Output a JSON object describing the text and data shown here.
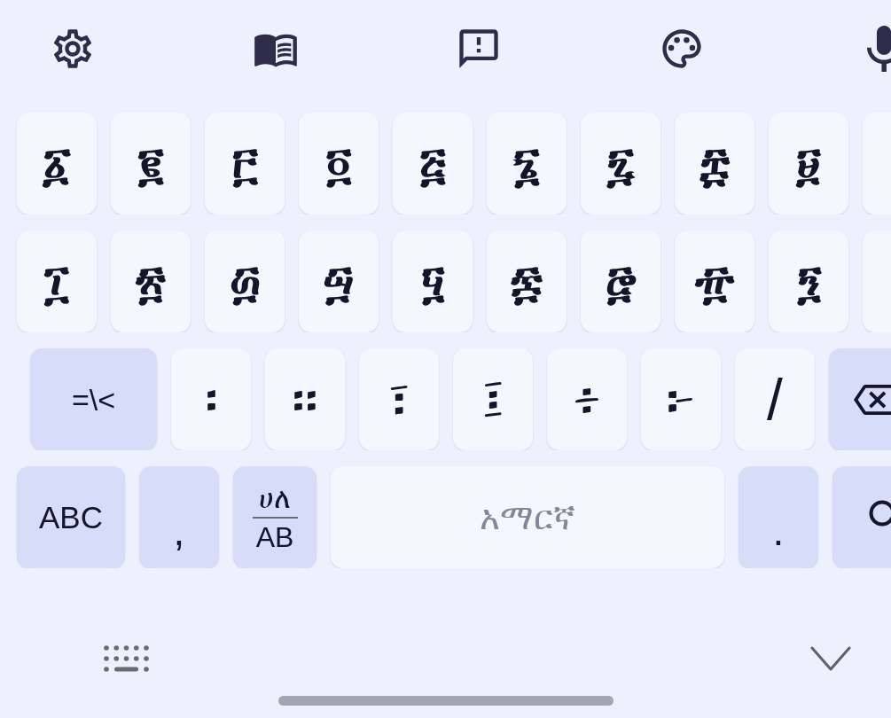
{
  "rows": [
    {
      "keys": [
        {
          "kind": "digit",
          "label": "፩"
        },
        {
          "kind": "digit",
          "label": "፪"
        },
        {
          "kind": "digit",
          "label": "፫"
        },
        {
          "kind": "digit",
          "label": "፬"
        },
        {
          "kind": "digit",
          "label": "፭"
        },
        {
          "kind": "digit",
          "label": "፮"
        },
        {
          "kind": "digit",
          "label": "፯"
        },
        {
          "kind": "digit",
          "label": "፰"
        },
        {
          "kind": "digit",
          "label": "፱"
        },
        {
          "kind": "edge"
        }
      ]
    },
    {
      "keys": [
        {
          "kind": "digit",
          "label": "፲"
        },
        {
          "kind": "digit",
          "label": "፳"
        },
        {
          "kind": "digit",
          "label": "፴"
        },
        {
          "kind": "digit",
          "label": "፵"
        },
        {
          "kind": "digit",
          "label": "፶"
        },
        {
          "kind": "digit",
          "label": "፷"
        },
        {
          "kind": "digit",
          "label": "፸"
        },
        {
          "kind": "digit",
          "label": "፹"
        },
        {
          "kind": "digit",
          "label": "፺"
        },
        {
          "kind": "edge"
        }
      ]
    },
    {
      "keys": [
        {
          "kind": "symbols",
          "label": "=\\<"
        },
        {
          "kind": "punct",
          "label": "፡"
        },
        {
          "kind": "punct",
          "label": "።"
        },
        {
          "kind": "punct",
          "label": "፣"
        },
        {
          "kind": "punct",
          "label": "፤"
        },
        {
          "kind": "punct",
          "label": "፥"
        },
        {
          "kind": "punct",
          "label": "፦"
        },
        {
          "kind": "punct",
          "label": "/"
        },
        {
          "kind": "backspace"
        }
      ]
    },
    {
      "keys": [
        {
          "kind": "letters",
          "label": "ABC"
        },
        {
          "kind": "mark",
          "label": ","
        },
        {
          "kind": "script",
          "top": "ሀለ",
          "bottom": "AB"
        },
        {
          "kind": "space",
          "label": "አማርኛ"
        },
        {
          "kind": "mark",
          "label": "."
        },
        {
          "kind": "enter"
        }
      ]
    }
  ]
}
